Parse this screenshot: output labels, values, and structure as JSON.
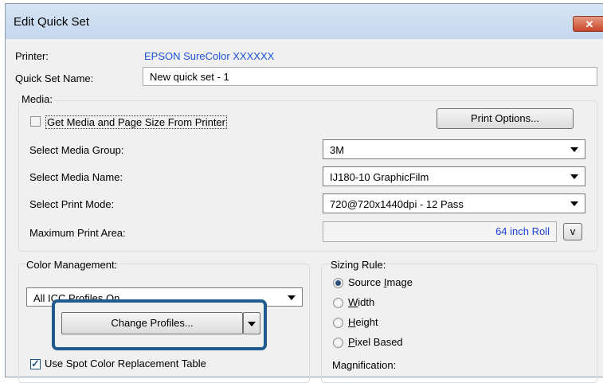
{
  "window": {
    "title": "Edit Quick Set",
    "close_glyph": "✕"
  },
  "printer": {
    "label": "Printer:",
    "value": "EPSON SureColor XXXXXX"
  },
  "quick_set": {
    "label": "Quick Set Name:",
    "value": "New quick set - 1"
  },
  "media": {
    "title": "Media:",
    "get_from_printer_label": "Get Media and Page Size From Printer",
    "get_from_printer_checked": false,
    "print_options_label": "Print Options...",
    "media_group_label": "Select Media Group:",
    "media_group_value": "3M",
    "media_name_label": "Select Media Name:",
    "media_name_value": "IJ180-10 GraphicFilm",
    "print_mode_label": "Select Print Mode:",
    "print_mode_value": "720@720x1440dpi - 12 Pass",
    "max_area_label": "Maximum Print Area:",
    "max_area_value": "64 inch Roll",
    "max_area_button": "v"
  },
  "color_management": {
    "title": "Color Management:",
    "profiles_value": "All ICC Profiles On",
    "change_profiles_label": "Change Profiles...",
    "spot_color_label": "Use Spot Color Replacement Table",
    "spot_color_checked": true
  },
  "sizing_rule": {
    "title": "Sizing Rule:",
    "options": [
      {
        "label": "Source Image",
        "underline": "I",
        "selected": true
      },
      {
        "label": "Width",
        "underline": "W",
        "selected": false
      },
      {
        "label": "Height",
        "underline": "H",
        "selected": false
      },
      {
        "label": "Pixel Based",
        "underline": "P",
        "selected": false
      }
    ],
    "magnification_label": "Magnification:"
  },
  "colors": {
    "highlight": "#1f5b8e",
    "printer_value": "#1d52d8",
    "area_value": "#1d3fd6"
  }
}
